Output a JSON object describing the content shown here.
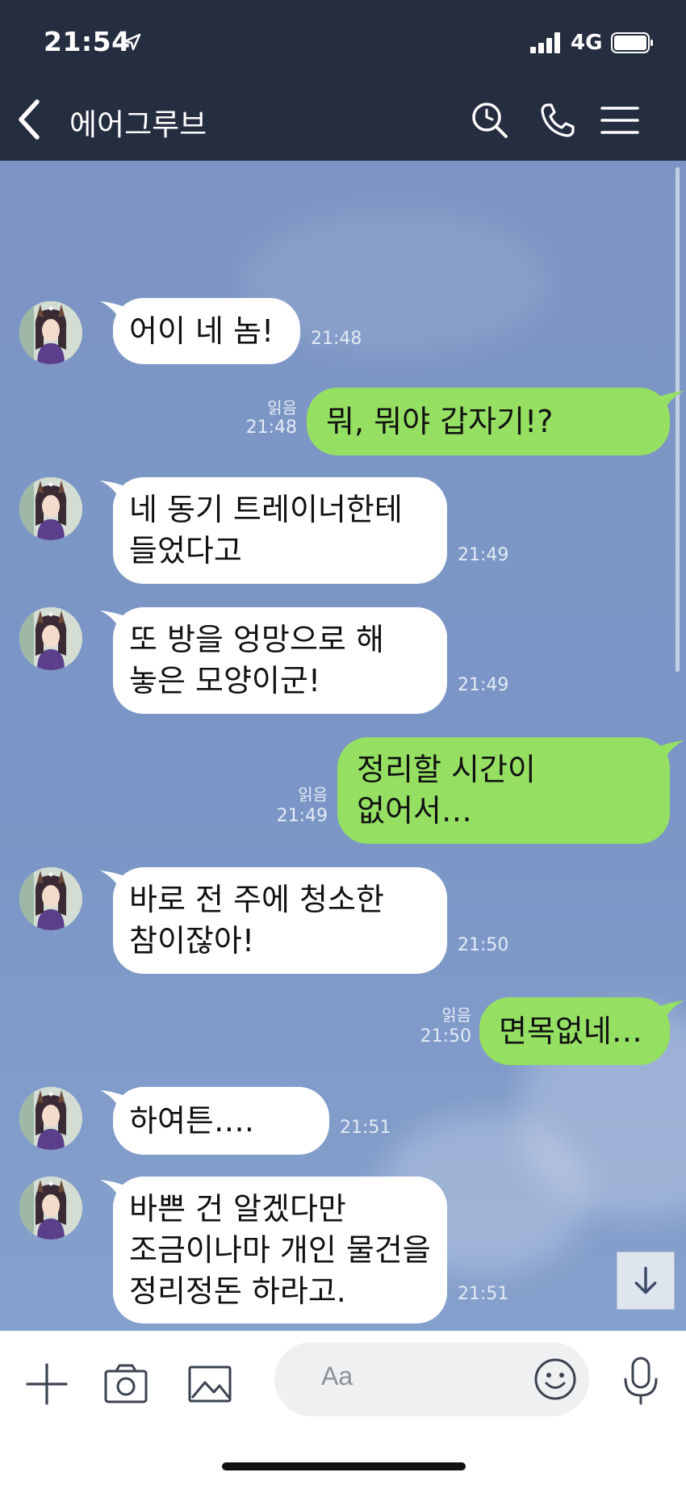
{
  "status_bar": {
    "time": "21:54",
    "network": "4G"
  },
  "header": {
    "title": "에어그루브"
  },
  "messages": [
    {
      "dir": "in",
      "lines": [
        "어이 네 놈!"
      ],
      "time": "21:48"
    },
    {
      "dir": "out",
      "lines": [
        "뭐, 뭐야 갑자기!?"
      ],
      "time": "21:48",
      "read": "읽음"
    },
    {
      "dir": "in",
      "lines": [
        "네 동기 트레이너한테",
        "들었다고"
      ],
      "time": "21:49"
    },
    {
      "dir": "in",
      "lines": [
        "또 방을 엉망으로 해",
        "놓은 모양이군!"
      ],
      "time": "21:49"
    },
    {
      "dir": "out",
      "lines": [
        "정리할 시간이",
        "없어서…"
      ],
      "time": "21:49",
      "read": "읽음"
    },
    {
      "dir": "in",
      "lines": [
        "바로 전 주에 청소한",
        "참이잖아!"
      ],
      "time": "21:50"
    },
    {
      "dir": "out",
      "lines": [
        "면목없네…"
      ],
      "time": "21:50",
      "read": "읽음"
    },
    {
      "dir": "in",
      "lines": [
        "하여튼….",
        ""
      ],
      "time": "21:51"
    },
    {
      "dir": "in",
      "lines": [
        "바쁜 건 알겠다만",
        "조금이나마 개인 물건을",
        "정리정돈 하라고."
      ],
      "time": "21:51"
    }
  ],
  "composer": {
    "placeholder": "Aa"
  },
  "colors": {
    "header_bg": "#252d40",
    "chat_bg": "#7b96c6",
    "incoming_bubble": "#ffffff",
    "outgoing_bubble": "#95df63"
  },
  "icons": [
    "location-arrow-icon",
    "signal-icon",
    "battery-icon",
    "back-chevron-icon",
    "search-icon",
    "phone-icon",
    "menu-icon",
    "plus-icon",
    "camera-icon",
    "image-icon",
    "emoji-icon",
    "microphone-icon",
    "arrow-down-icon"
  ]
}
